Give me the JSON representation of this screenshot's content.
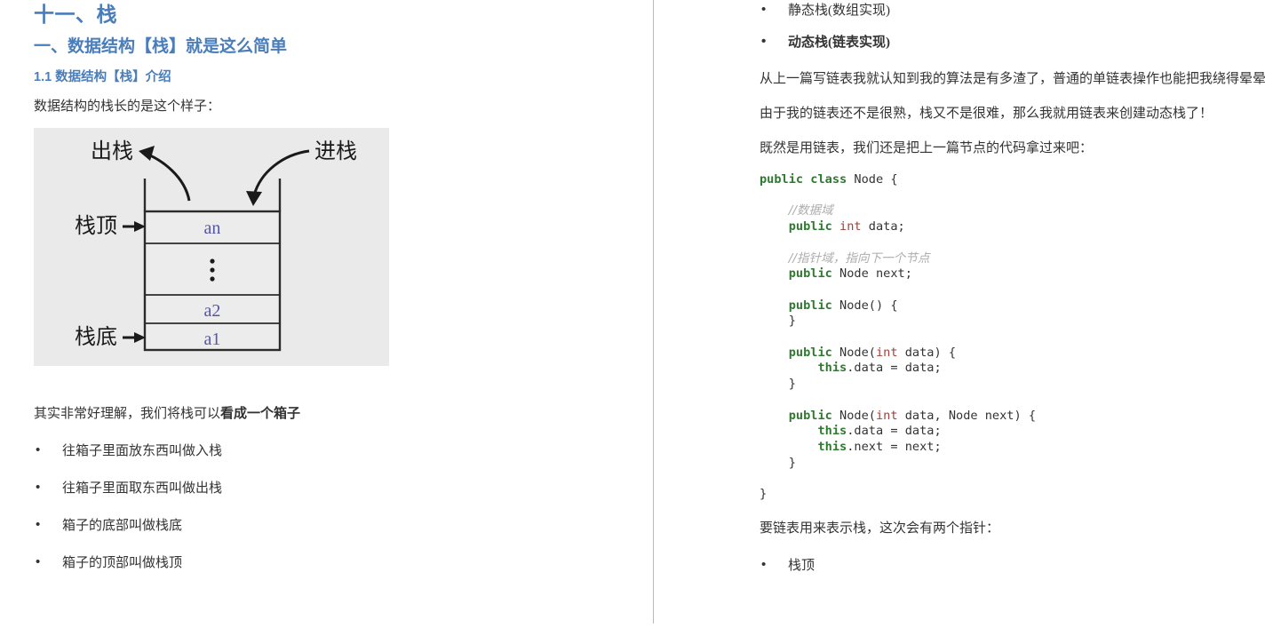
{
  "document": {
    "title": "十一、栈",
    "left_column": {
      "heading_main": "十一、栈",
      "heading_section": "一、数据结构【栈】就是这么简单",
      "heading_sub": "1.1 数据结构【栈】介绍",
      "intro_paragraph": "数据结构的栈长的是这个样子：",
      "figure": {
        "name": "stack-diagram",
        "background_color": "#eaeaea",
        "label_pop": "出栈",
        "label_push": "进栈",
        "label_top": "栈顶",
        "label_bottom": "栈底",
        "cells": [
          "an",
          "⋮",
          "a2",
          "a1"
        ],
        "cell_text_color": "#5555aa"
      },
      "explain_paragraph_plain": "其实非常好理解，我们将栈可以",
      "explain_paragraph_bold": "看成一个箱子",
      "bullets": [
        "往箱子里面放东西叫做入栈",
        "往箱子里面取东西叫做出栈",
        "箱子的底部叫做栈底",
        "箱子的顶部叫做栈顶"
      ]
    },
    "right_column": {
      "bullets_top": [
        {
          "text": "静态栈(数组实现)",
          "bold": false
        },
        {
          "text": "动态栈(链表实现)",
          "bold": true
        }
      ],
      "paragraph_1": "从上一篇写链表我就认知到我的算法是有多渣了，普通的单链表操作也能把我绕得晕晕的。",
      "paragraph_2": "由于我的链表还不是很熟，栈又不是很难，那么我就用链表来创建动态栈了！",
      "paragraph_3": "既然是用链表，我们还是把上一篇节点的代码拿过来吧：",
      "code": {
        "language": "java",
        "lines": [
          "public class Node {",
          "",
          "    //数据域",
          "    public int data;",
          "",
          "    //指针域，指向下一个节点",
          "    public Node next;",
          "",
          "    public Node() {",
          "    }",
          "",
          "    public Node(int data) {",
          "        this.data = data;",
          "    }",
          "",
          "    public Node(int data, Node next) {",
          "        this.data = data;",
          "        this.next = next;",
          "    }",
          "",
          "}"
        ],
        "colors": {
          "keyword": "#2f7a30",
          "type": "#a2403a",
          "comment": "#adadad",
          "plain": "#333333"
        }
      },
      "paragraph_4": "要链表用来表示栈，这次会有两个指针：",
      "bullets_bottom": [
        "栈顶"
      ]
    },
    "theme": {
      "heading_color": "#4a7ebb",
      "text_color": "#333333",
      "divider_color": "#b9b9b9",
      "background": "#ffffff"
    }
  }
}
